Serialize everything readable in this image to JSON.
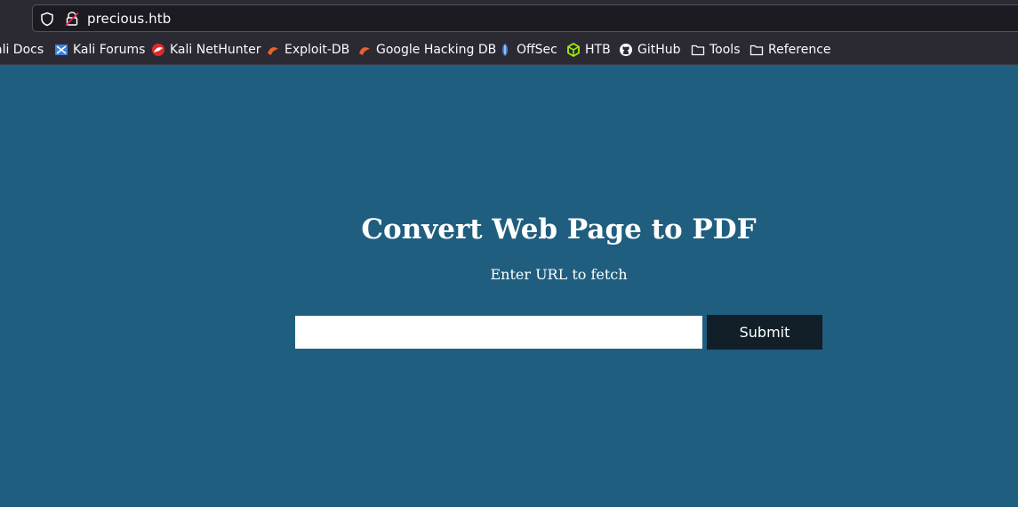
{
  "browser": {
    "url": "precious.htb"
  },
  "bookmarks": [
    {
      "label": "ali Docs",
      "icon": "kali-docs-icon"
    },
    {
      "label": "Kali Forums",
      "icon": "kali-forums-icon"
    },
    {
      "label": "Kali NetHunter",
      "icon": "kali-nethunter-icon"
    },
    {
      "label": "Exploit-DB",
      "icon": "exploit-db-icon"
    },
    {
      "label": "Google Hacking DB",
      "icon": "google-hacking-db-icon"
    },
    {
      "label": "OffSec",
      "icon": "offsec-icon"
    },
    {
      "label": "HTB",
      "icon": "htb-icon"
    },
    {
      "label": "GitHub",
      "icon": "github-icon"
    },
    {
      "label": "Tools",
      "icon": "folder-icon"
    },
    {
      "label": "Reference",
      "icon": "folder-icon"
    }
  ],
  "page": {
    "title": "Convert Web Page to PDF",
    "subtitle": "Enter URL to fetch",
    "url_input_value": "",
    "submit_label": "Submit"
  },
  "colors": {
    "page_background": "#1f5e7e",
    "button_background": "#121f28",
    "chrome_background": "#2b2a33"
  }
}
